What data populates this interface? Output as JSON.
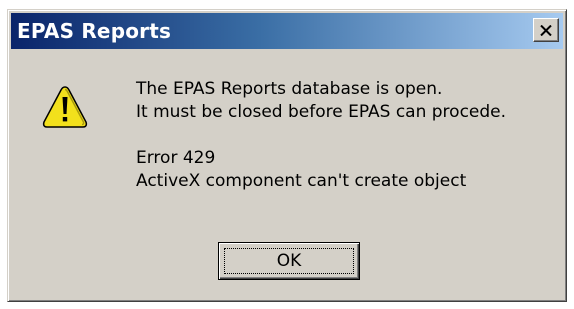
{
  "window": {
    "title": "EPAS Reports",
    "close_icon": "close-icon"
  },
  "message": {
    "icon": "warning-icon",
    "line1": "The EPAS Reports database is open.",
    "line2": "It must be closed before EPAS can procede.",
    "line3": "Error 429",
    "line4": "ActiveX component can't create object"
  },
  "buttons": {
    "ok_label": "OK"
  },
  "colors": {
    "titlebar_start": "#0a246a",
    "titlebar_end": "#a6caf0",
    "dialog_face": "#d4d0c8",
    "warning_yellow": "#f2e01c"
  }
}
